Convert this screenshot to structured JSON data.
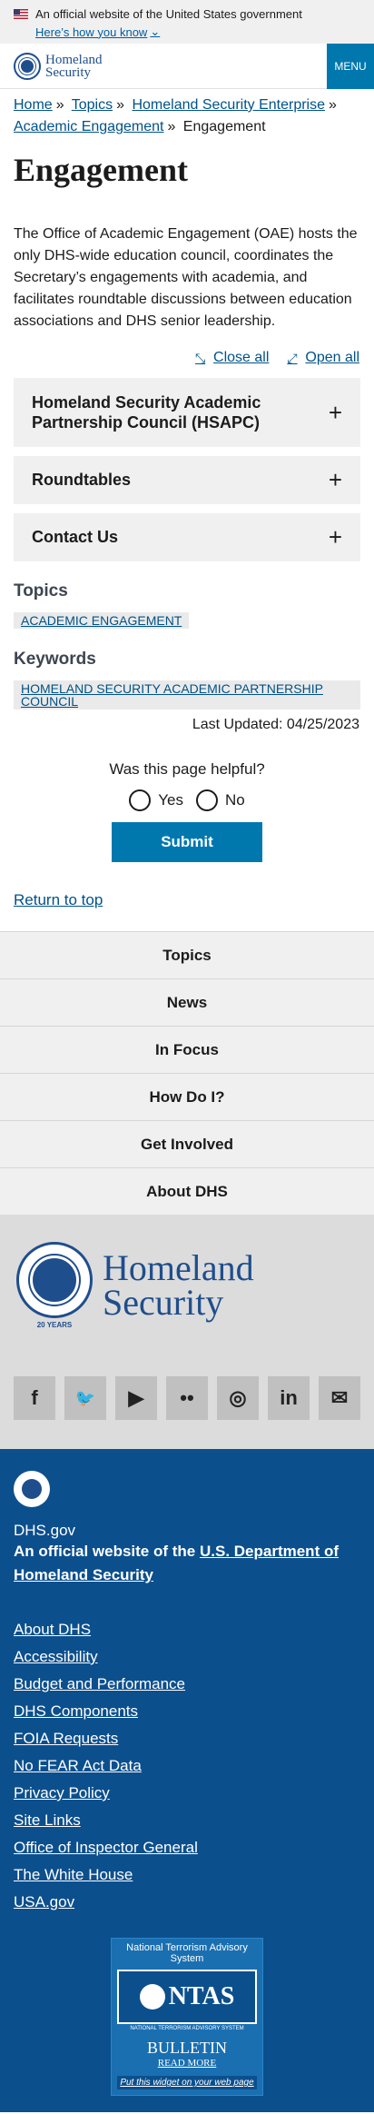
{
  "gov_banner": {
    "official": "An official website of the United States government",
    "how": "Here’s how you know"
  },
  "header": {
    "logo_line1": "Homeland",
    "logo_line2": "Security",
    "menu_label": "MENU"
  },
  "breadcrumb": {
    "home": "Home",
    "topics": "Topics",
    "enterprise": "Homeland Security Enterprise",
    "academic": "Academic Engagement",
    "current": "Engagement",
    "sep": "»"
  },
  "page": {
    "title": "Engagement",
    "intro": "The Office of Academic Engagement (OAE) hosts the only DHS-wide education council, coordinates the Secretary’s engagements with academia, and facilitates roundtable discussions between education associations and DHS senior leadership.",
    "close_all": "Close all",
    "open_all": "Open all",
    "accordion": [
      {
        "label": "Homeland Security Academic Partnership Council (HSAPC)"
      },
      {
        "label": "Roundtables"
      },
      {
        "label": "Contact Us"
      }
    ],
    "topics_heading": "Topics",
    "topic_tag": "ACADEMIC ENGAGEMENT",
    "keywords_heading": "Keywords",
    "keyword_tag": "HOMELAND SECURITY ACADEMIC PARTNERSHIP COUNCIL",
    "last_updated": "Last Updated: 04/25/2023"
  },
  "feedback": {
    "question": "Was this page helpful?",
    "yes": "Yes",
    "no": "No",
    "submit": "Submit"
  },
  "return_top": "Return to top",
  "footer_nav": [
    "Topics",
    "News",
    "In Focus",
    "How Do I?",
    "Get Involved",
    "About DHS"
  ],
  "footer_brand": {
    "line1": "Homeland",
    "line2": "Security",
    "years": "20 YEARS"
  },
  "socials": [
    {
      "icon": "facebook-icon",
      "glyph": "f"
    },
    {
      "icon": "twitter-icon",
      "glyph": "🐦"
    },
    {
      "icon": "youtube-icon",
      "glyph": "▶"
    },
    {
      "icon": "flickr-icon",
      "glyph": "••"
    },
    {
      "icon": "instagram-icon",
      "glyph": "◎"
    },
    {
      "icon": "linkedin-icon",
      "glyph": "in"
    },
    {
      "icon": "email-icon",
      "glyph": "✉"
    }
  ],
  "footer_dark": {
    "site": "DHS.gov",
    "official_prefix": "An official website of the",
    "official_link": "U.S. Department of Homeland Security",
    "links": [
      "About DHS",
      "Accessibility",
      "Budget and Performance",
      "DHS Components",
      "FOIA Requests",
      "No FEAR Act Data",
      "Privacy Policy",
      "Site Links",
      "Office of Inspector General",
      "The White House",
      "USA.gov"
    ]
  },
  "ntas": {
    "title": "National Terrorism Advisory System",
    "name": "NTAS",
    "sub": "NATIONAL TERRORISM ADVISORY SYSTEM",
    "bulletin": "BULLETIN",
    "read_more": "READ MORE",
    "widget": "Put this widget on your web page"
  },
  "colors": {
    "accent": "#0078ae",
    "link": "#005288",
    "footer_dark": "#0c4f8d"
  }
}
